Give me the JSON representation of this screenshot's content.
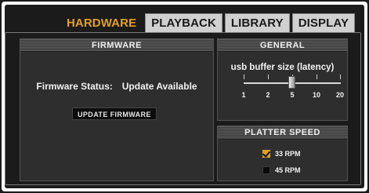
{
  "tabs": [
    {
      "label": "HARDWARE",
      "active": true
    },
    {
      "label": "PLAYBACK",
      "active": false
    },
    {
      "label": "LIBRARY",
      "active": false
    },
    {
      "label": "DISPLAY",
      "active": false
    }
  ],
  "firmware": {
    "title": "FIRMWARE",
    "status_label": "Firmware Status:",
    "status_value": "Update Available",
    "update_button": "UPDATE FIRMWARE"
  },
  "general": {
    "title": "GENERAL",
    "slider_label": "usb buffer size (latency)",
    "ticks": [
      "1",
      "2",
      "5",
      "10",
      "20"
    ],
    "selected_value": "5"
  },
  "platter_speed": {
    "title": "PLATTER SPEED",
    "options": [
      {
        "label": "33 RPM",
        "checked": true
      },
      {
        "label": "45 RPM",
        "checked": false
      }
    ]
  },
  "colors": {
    "accent": "#e2a024",
    "panel": "#2e2e2e",
    "background": "#1b1b1b"
  }
}
